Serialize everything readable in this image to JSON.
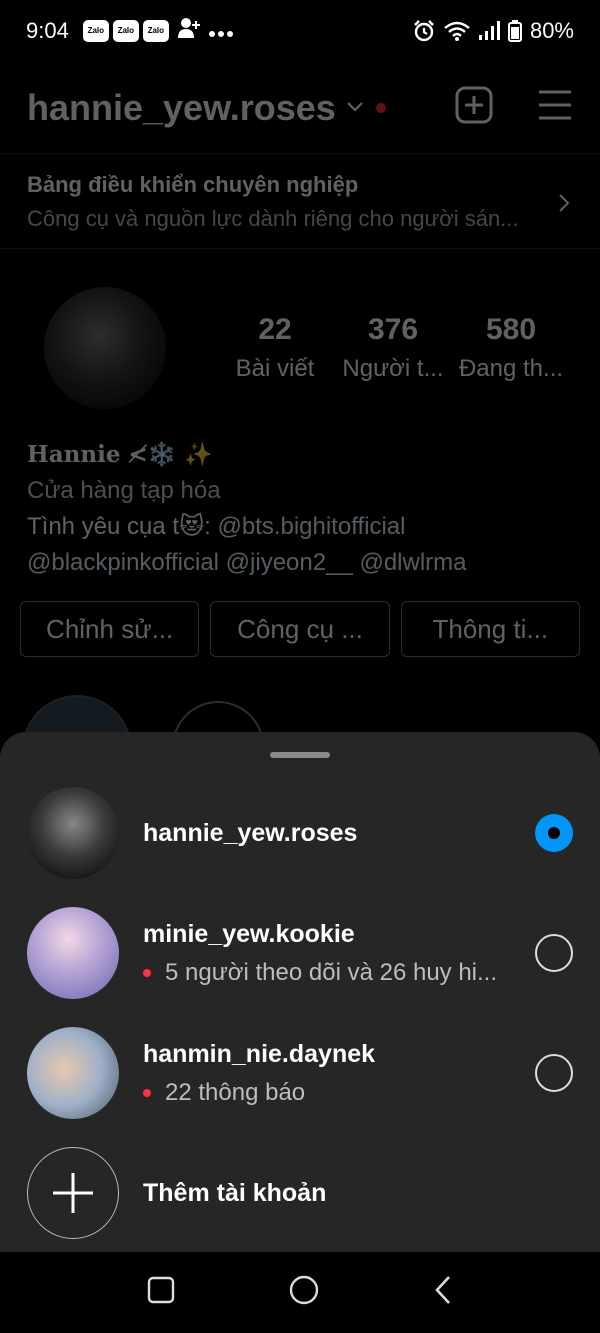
{
  "status": {
    "time": "9:04",
    "notif_icons": [
      "Zalo",
      "Zalo",
      "Zalo"
    ],
    "battery": "80%"
  },
  "header": {
    "username": "hannie_yew.roses"
  },
  "pro_dashboard": {
    "title": "Bảng điều khiển chuyên nghiệp",
    "subtitle": "Công cụ và nguồn lực dành riêng cho người sán..."
  },
  "stats": [
    {
      "value": "22",
      "label": "Bài viết"
    },
    {
      "value": "376",
      "label": "Người t..."
    },
    {
      "value": "580",
      "label": "Đang th..."
    }
  ],
  "bio": {
    "name": "Hannie ≮❄️ ✨",
    "category": "Cửa hàng tạp hóa",
    "line1_prefix": "Tình yêu cụa t😻: ",
    "line1_link": "@bts.bighitofficial",
    "line2": "@blackpinkofficial @jiyeon2__  @dlwlrma"
  },
  "buttons": [
    {
      "label": "Chỉnh sử..."
    },
    {
      "label": "Công cụ ..."
    },
    {
      "label": "Thông ti..."
    }
  ],
  "accounts": [
    {
      "name": "hannie_yew.roses",
      "sub": "",
      "selected": true
    },
    {
      "name": "minie_yew.kookie",
      "sub": "5 người theo dõi và 26 huy hi...",
      "selected": false
    },
    {
      "name": "hanmin_nie.daynek",
      "sub": "22 thông báo",
      "selected": false
    }
  ],
  "add_account_label": "Thêm tài khoản",
  "colors": {
    "sheet_bg": "#262626",
    "accent_blue": "#0095f6",
    "notif_red": "#ff3040"
  }
}
